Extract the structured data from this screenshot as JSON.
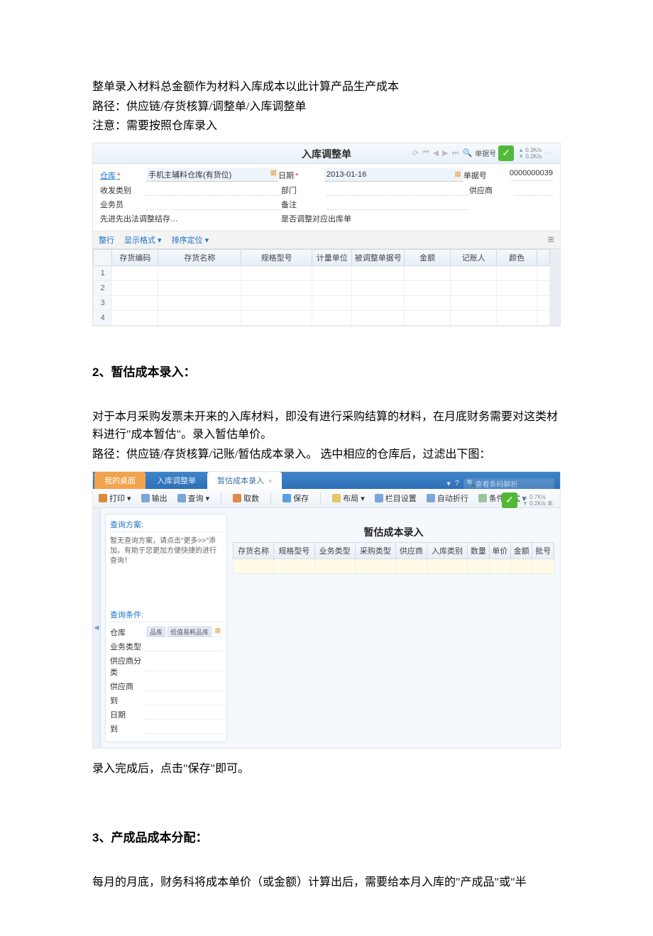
{
  "intro": {
    "line1": "整单录入材料总金额作为材料入库成本以此计算产品生产成本",
    "line2": "路径：供应链/存货核算/调整单/入库调整单",
    "line3": "注意：需要按照仓库录入"
  },
  "shot1": {
    "title": "入库调整单",
    "doc_no_label": "单据号",
    "doc_no": "0000000039",
    "speed_up": "0.3K/s",
    "speed_dn": "0.2K/s",
    "form": {
      "warehouse_label": "仓库",
      "warehouse_value": "手机主辅料仓库(有货位)",
      "date_label": "日期",
      "date_value": "2013-01-16",
      "docno_label": "单据号",
      "docno_value": "0000000039",
      "rcv_label": "收发类别",
      "dept_label": "部门",
      "vendor_label": "供应商",
      "operator_label": "业务员",
      "remark_label": "备注",
      "fifo_label": "先进先出法调整结存…",
      "adjust_out_label": "是否调整对应出库单"
    },
    "toolbar2": {
      "rows": "整行",
      "fmt": "显示格式 ▾",
      "sort": "排序定位 ▾"
    },
    "columns": [
      "",
      "存货编码",
      "存货名称",
      "规格型号",
      "计量单位",
      "被调整单据号",
      "金额",
      "记账人",
      "颜色",
      ""
    ],
    "row_nums": [
      "1",
      "2",
      "3",
      "4"
    ]
  },
  "section2": {
    "heading": "2、暂估成本录入：",
    "p1": "对于本月采购发票未开来的入库材料，即没有进行采购结算的材料，在月底财务需要对这类材料进行\"成本暂估\"。录入暂估单价。",
    "p2": "路径：供应链/存货核算/记账/暂估成本录入。 选中相应的仓库后，过滤出下图："
  },
  "shot2": {
    "tabs": {
      "desktop": "我的桌面",
      "adj": "入库调整单",
      "active": "暂估成本录入"
    },
    "search_placeholder": "查看条码解析",
    "toolbar": {
      "print": "打印 ▾",
      "export": "输出",
      "query": "查询 ▾",
      "cancel": "取数",
      "save": "保存",
      "layout": "布局 ▾",
      "cols": "栏目设置",
      "wrap": "自动折行",
      "cond": "条件格式 ▾"
    },
    "speed_up": "0.7K/s",
    "speed_dn": "0.2K/s",
    "speed_suffix": "本",
    "main_title": "暂估成本录入",
    "filter": {
      "plan_title": "查询方案:",
      "plan_tip": "暂无查询方案，请点击\"更多>>\"添加，有助于您更加方便快捷的进行查询！",
      "cond_title": "查询条件:",
      "wh_label": "仓库",
      "wh_sel1": "品库",
      "wh_sel2": "低值易耗品库",
      "biz_label": "业务类型",
      "cat_label": "供应商分类",
      "vendor_label": "供应商",
      "to1_label": "到",
      "date_label": "日期",
      "to2_label": "到"
    },
    "columns": [
      "存货名称",
      "规格型号",
      "业务类型",
      "采购类型",
      "供应商",
      "入库类别",
      "数量",
      "单价",
      "金额",
      "批号"
    ]
  },
  "after2": "录入完成后，点击\"保存\"即可。",
  "section3": {
    "heading": "3、产成品成本分配：",
    "p1": "每月的月底，财务科将成本单价（或金额）计算出后，需要给本月入库的\"产成品\"或\"半"
  }
}
